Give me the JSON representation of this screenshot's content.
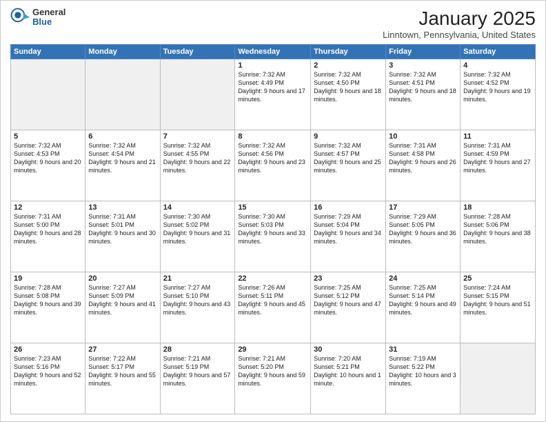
{
  "header": {
    "logo_general": "General",
    "logo_blue": "Blue",
    "month_title": "January 2025",
    "location": "Linntown, Pennsylvania, United States"
  },
  "weekdays": [
    "Sunday",
    "Monday",
    "Tuesday",
    "Wednesday",
    "Thursday",
    "Friday",
    "Saturday"
  ],
  "weeks": [
    [
      {
        "day": "",
        "empty": true
      },
      {
        "day": "",
        "empty": true
      },
      {
        "day": "",
        "empty": true
      },
      {
        "day": "1",
        "sunrise": "7:32 AM",
        "sunset": "4:49 PM",
        "daylight": "9 hours and 17 minutes."
      },
      {
        "day": "2",
        "sunrise": "7:32 AM",
        "sunset": "4:50 PM",
        "daylight": "9 hours and 18 minutes."
      },
      {
        "day": "3",
        "sunrise": "7:32 AM",
        "sunset": "4:51 PM",
        "daylight": "9 hours and 18 minutes."
      },
      {
        "day": "4",
        "sunrise": "7:32 AM",
        "sunset": "4:52 PM",
        "daylight": "9 hours and 19 minutes."
      }
    ],
    [
      {
        "day": "5",
        "sunrise": "7:32 AM",
        "sunset": "4:53 PM",
        "daylight": "9 hours and 20 minutes."
      },
      {
        "day": "6",
        "sunrise": "7:32 AM",
        "sunset": "4:54 PM",
        "daylight": "9 hours and 21 minutes."
      },
      {
        "day": "7",
        "sunrise": "7:32 AM",
        "sunset": "4:55 PM",
        "daylight": "9 hours and 22 minutes."
      },
      {
        "day": "8",
        "sunrise": "7:32 AM",
        "sunset": "4:56 PM",
        "daylight": "9 hours and 23 minutes."
      },
      {
        "day": "9",
        "sunrise": "7:32 AM",
        "sunset": "4:57 PM",
        "daylight": "9 hours and 25 minutes."
      },
      {
        "day": "10",
        "sunrise": "7:31 AM",
        "sunset": "4:58 PM",
        "daylight": "9 hours and 26 minutes."
      },
      {
        "day": "11",
        "sunrise": "7:31 AM",
        "sunset": "4:59 PM",
        "daylight": "9 hours and 27 minutes."
      }
    ],
    [
      {
        "day": "12",
        "sunrise": "7:31 AM",
        "sunset": "5:00 PM",
        "daylight": "9 hours and 28 minutes."
      },
      {
        "day": "13",
        "sunrise": "7:31 AM",
        "sunset": "5:01 PM",
        "daylight": "9 hours and 30 minutes."
      },
      {
        "day": "14",
        "sunrise": "7:30 AM",
        "sunset": "5:02 PM",
        "daylight": "9 hours and 31 minutes."
      },
      {
        "day": "15",
        "sunrise": "7:30 AM",
        "sunset": "5:03 PM",
        "daylight": "9 hours and 33 minutes."
      },
      {
        "day": "16",
        "sunrise": "7:29 AM",
        "sunset": "5:04 PM",
        "daylight": "9 hours and 34 minutes."
      },
      {
        "day": "17",
        "sunrise": "7:29 AM",
        "sunset": "5:05 PM",
        "daylight": "9 hours and 36 minutes."
      },
      {
        "day": "18",
        "sunrise": "7:28 AM",
        "sunset": "5:06 PM",
        "daylight": "9 hours and 38 minutes."
      }
    ],
    [
      {
        "day": "19",
        "sunrise": "7:28 AM",
        "sunset": "5:08 PM",
        "daylight": "9 hours and 39 minutes."
      },
      {
        "day": "20",
        "sunrise": "7:27 AM",
        "sunset": "5:09 PM",
        "daylight": "9 hours and 41 minutes."
      },
      {
        "day": "21",
        "sunrise": "7:27 AM",
        "sunset": "5:10 PM",
        "daylight": "9 hours and 43 minutes."
      },
      {
        "day": "22",
        "sunrise": "7:26 AM",
        "sunset": "5:11 PM",
        "daylight": "9 hours and 45 minutes."
      },
      {
        "day": "23",
        "sunrise": "7:25 AM",
        "sunset": "5:12 PM",
        "daylight": "9 hours and 47 minutes."
      },
      {
        "day": "24",
        "sunrise": "7:25 AM",
        "sunset": "5:14 PM",
        "daylight": "9 hours and 49 minutes."
      },
      {
        "day": "25",
        "sunrise": "7:24 AM",
        "sunset": "5:15 PM",
        "daylight": "9 hours and 51 minutes."
      }
    ],
    [
      {
        "day": "26",
        "sunrise": "7:23 AM",
        "sunset": "5:16 PM",
        "daylight": "9 hours and 52 minutes."
      },
      {
        "day": "27",
        "sunrise": "7:22 AM",
        "sunset": "5:17 PM",
        "daylight": "9 hours and 55 minutes."
      },
      {
        "day": "28",
        "sunrise": "7:21 AM",
        "sunset": "5:19 PM",
        "daylight": "9 hours and 57 minutes."
      },
      {
        "day": "29",
        "sunrise": "7:21 AM",
        "sunset": "5:20 PM",
        "daylight": "9 hours and 59 minutes."
      },
      {
        "day": "30",
        "sunrise": "7:20 AM",
        "sunset": "5:21 PM",
        "daylight": "10 hours and 1 minute."
      },
      {
        "day": "31",
        "sunrise": "7:19 AM",
        "sunset": "5:22 PM",
        "daylight": "10 hours and 3 minutes."
      },
      {
        "day": "",
        "empty": true
      }
    ]
  ]
}
